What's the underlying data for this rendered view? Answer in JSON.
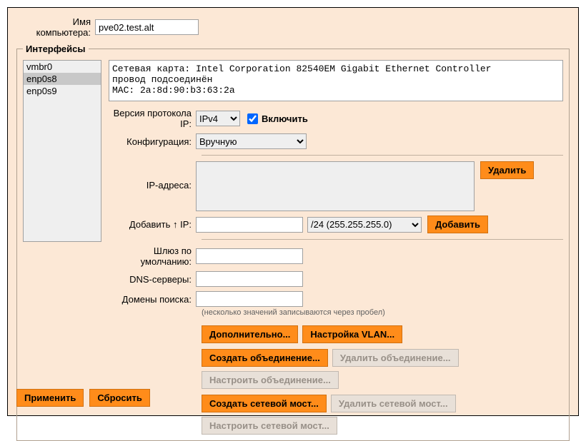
{
  "hostname": {
    "label": "Имя компьютера:",
    "value": "pve02.test.alt"
  },
  "interfaces_legend": "Интерфейсы",
  "interfaces": [
    {
      "name": "vmbr0",
      "selected": false
    },
    {
      "name": "enp0s8",
      "selected": true
    },
    {
      "name": "enp0s9",
      "selected": false
    }
  ],
  "info_text": "Сетевая карта: Intel Corporation 82540EM Gigabit Ethernet Controller\nпровод подсоединён\nMAC: 2a:8d:90:b3:63:2a",
  "ip_version": {
    "label": "Версия протокола IP:",
    "value": "IPv4",
    "enable_label": "Включить",
    "enabled": true
  },
  "config": {
    "label": "Конфигурация:",
    "value": "Вручную"
  },
  "ip_addresses": {
    "label": "IP-адреса:",
    "delete_label": "Удалить"
  },
  "add_ip": {
    "label": "Добавить ↑ IP:",
    "value": "",
    "mask": "/24 (255.255.255.0)",
    "button": "Добавить"
  },
  "gateway": {
    "label": "Шлюз по умолчанию:",
    "value": ""
  },
  "dns": {
    "label": "DNS-серверы:",
    "value": ""
  },
  "search": {
    "label": "Домены поиска:",
    "value": ""
  },
  "hint": "(несколько значений записываются через пробел)",
  "buttons": {
    "advanced": "Дополнительно...",
    "vlan": "Настройка VLAN...",
    "create_bond": "Создать объединение...",
    "delete_bond": "Удалить объединение...",
    "config_bond": "Настроить объединение...",
    "create_bridge": "Создать сетевой мост...",
    "delete_bridge": "Удалить сетевой мост...",
    "config_bridge": "Настроить сетевой мост...",
    "apply": "Применить",
    "reset": "Сбросить"
  }
}
